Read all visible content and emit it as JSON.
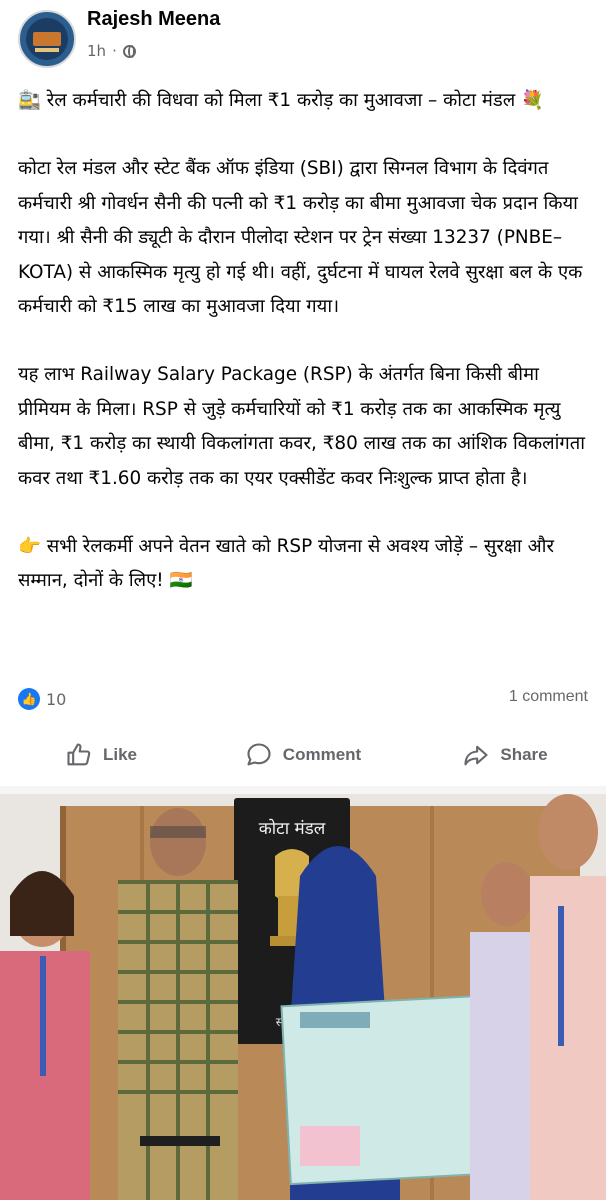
{
  "post": {
    "author": "Rajesh Meena",
    "time": "1h",
    "visibility_icon": "globe-icon",
    "paragraphs": [
      "🚉 रेल कर्मचारी की विधवा को मिला ₹1 करोड़ का मुआवजा – कोटा मंडल 💐",
      "कोटा रेल मंडल और स्टेट बैंक ऑफ इंडिया (SBI) द्वारा सिग्नल विभाग के दिवंगत कर्मचारी श्री गोवर्धन सैनी की पत्नी को ₹1 करोड़ का बीमा मुआवजा चेक प्रदान किया गया। श्री सैनी की ड्यूटी के दौरान पीलोदा स्टेशन पर ट्रेन संख्या 13237 (PNBE–KOTA) से आकस्मिक मृत्यु हो गई थी। वहीं, दुर्घटना में घायल रेलवे सुरक्षा बल के एक कर्मचारी को ₹15 लाख का मुआवजा दिया गया।",
      "यह लाभ Railway Salary Package (RSP) के अंतर्गत बिना किसी बीमा प्रीमियम के मिला। RSP से जुड़े कर्मचारियों को ₹1 करोड़ तक का आकस्मिक मृत्यु बीमा, ₹1 करोड़ का स्थायी विकलांगता कवर, ₹80 लाख तक का आंशिक विकलांगता कवर तथा ₹1.60 करोड़ तक का एयर एक्सीडेंट कवर निःशुल्क प्राप्त होता है।",
      "👉 सभी रेलकर्मी अपने वेतन खाते को RSP योजना से अवश्य जोड़ें – सुरक्षा और सम्मान, दोनों के लिए! 🇮🇳"
    ],
    "reaction_count": "10",
    "comment_count": "1 comment"
  },
  "actions": {
    "like": "Like",
    "comment": "Comment",
    "share": "Share"
  },
  "photo": {
    "board_text": "कोटा मंडल",
    "board_motto": "सत्यमेव"
  },
  "colors": {
    "accent": "#1877f2",
    "secondary_text": "#65676b"
  }
}
